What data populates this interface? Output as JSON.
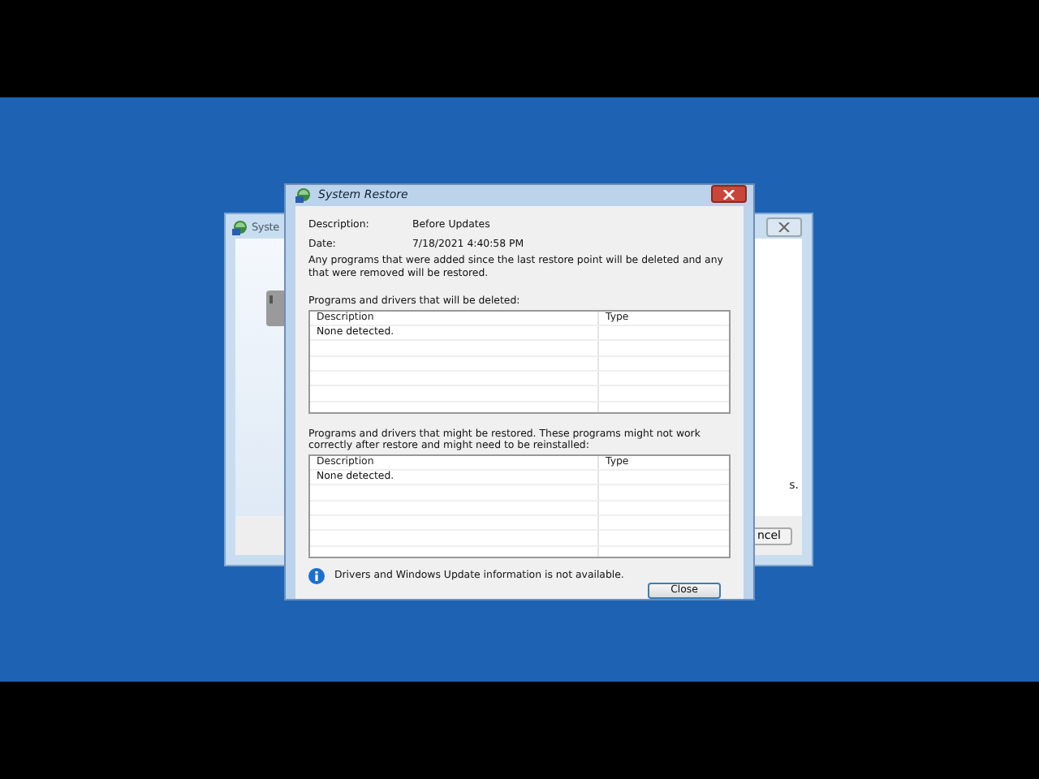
{
  "background_window": {
    "title": "Syste",
    "text_fragment": "s.",
    "button": "ncel"
  },
  "dialog": {
    "title": "System Restore",
    "fields": [
      {
        "label": "Description:",
        "value": "Before Updates"
      },
      {
        "label": "Date:",
        "value": "7/18/2021 4:40:58 PM"
      }
    ],
    "note": "Any programs that were added since the last restore point will be deleted and any that were removed will be restored.",
    "lists": [
      {
        "caption": "Programs and drivers that will be deleted:",
        "columns": [
          "Description",
          "Type"
        ],
        "rows": [
          [
            "None detected.",
            ""
          ]
        ]
      },
      {
        "caption": "Programs and drivers that might be restored. These programs might not work correctly after restore and might need to be reinstalled:",
        "columns": [
          "Description",
          "Type"
        ],
        "rows": [
          [
            "None detected.",
            ""
          ]
        ]
      }
    ],
    "info": "Drivers and Windows Update information is not available.",
    "buttons": [
      "Close"
    ]
  }
}
